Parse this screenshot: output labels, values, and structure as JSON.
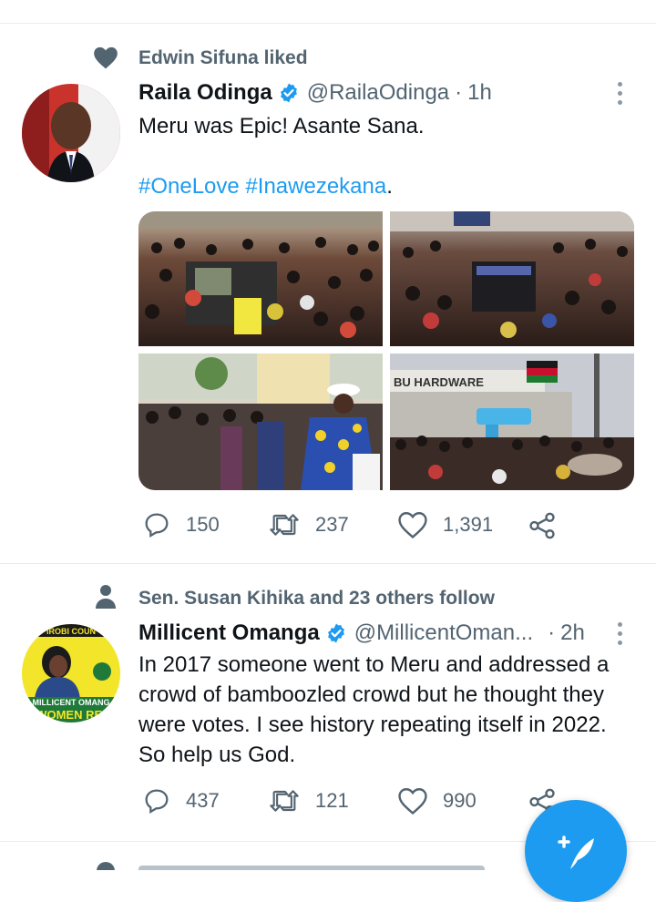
{
  "tweets": [
    {
      "social_context": "Edwin Sifuna liked",
      "social_icon": "heart-icon",
      "name": "Raila Odinga",
      "verified": true,
      "handle": "@RailaOdinga",
      "separator": "·",
      "time": "1h",
      "text": "Meru was Epic! Asante Sana.",
      "hashtags": "#OneLove #Inawezekana",
      "hashtags_suffix": ".",
      "photos": [
        "crowd-photo-1",
        "crowd-photo-2",
        "crowd-photo-3",
        "crowd-photo-4"
      ],
      "replies": "150",
      "retweets": "237",
      "likes": "1,391"
    },
    {
      "social_context": "Sen. Susan Kihika and 23 others follow",
      "social_icon": "person-icon",
      "name": "Millicent Omanga",
      "verified": true,
      "handle": "@MillicentOman...",
      "separator": "·",
      "time": "2h",
      "text_lines": [
        "In 2017 someone went to Meru and addressed a",
        "crowd of bamboozled crowd but he thought they",
        "were votes. I see history repeating itself in 2022.",
        "So help us God."
      ],
      "replies": "437",
      "retweets": "121",
      "likes": "990"
    }
  ],
  "colors": {
    "accent": "#1d9bf0",
    "secondary_text": "#536471",
    "divider": "#e6ecf0"
  },
  "compose_button_icon": "feather-plus-icon"
}
